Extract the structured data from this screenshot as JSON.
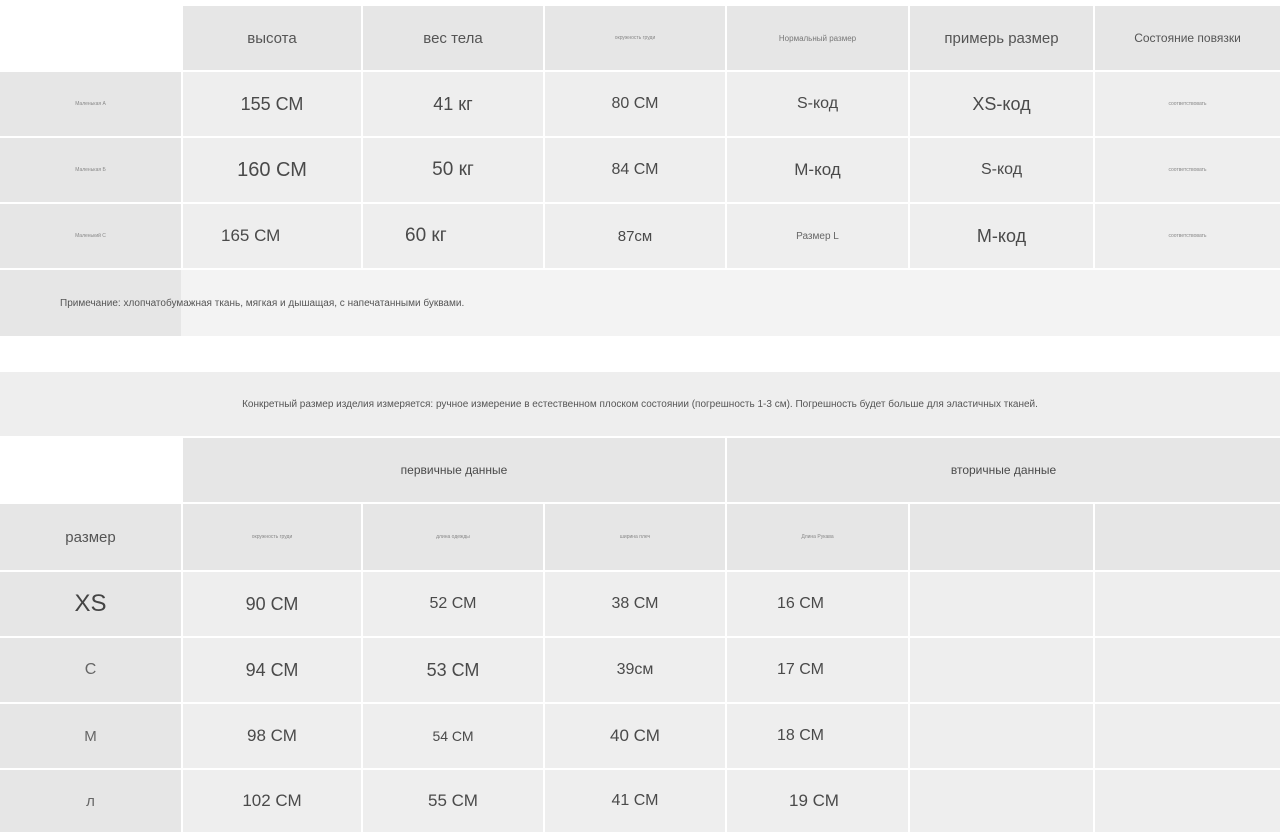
{
  "table1": {
    "headers": [
      "",
      "высота",
      "вес тела",
      "окружность груди",
      "Нормальный размер",
      "примерь размер",
      "Состояние повязки"
    ],
    "rows": [
      [
        "Маленькая А",
        "155 СМ",
        "41 кг",
        "80 СМ",
        "S-код",
        "XS-код",
        "соответствовать"
      ],
      [
        "Маленькая Б",
        "160 СМ",
        "50 кг",
        "84 СМ",
        "М-код",
        "S-код",
        "соответствовать"
      ],
      [
        "Маленький С",
        "165 СМ",
        "60 кг",
        "87см",
        "Размер L",
        "М-код",
        "соответствовать"
      ]
    ],
    "note": "Примечание: хлопчатобумажная ткань, мягкая и дышащая, с напечатанными буквами."
  },
  "banner": "Конкретный размер изделия измеряется: ручное измерение в естественном плоском состоянии (погрешность 1-3 см). Погрешность будет больше для эластичных тканей.",
  "table2": {
    "group_primary": "первичные данные",
    "group_secondary": "вторичные данные",
    "size_label": "размер",
    "subheaders": [
      "окружность груди",
      "длина одежды",
      "ширина плеч",
      "Длина Рукава",
      "",
      ""
    ],
    "rows": [
      [
        "XS",
        "90 СМ",
        "52 СМ",
        "38 СМ",
        "16 СМ",
        "",
        ""
      ],
      [
        "С",
        "94 СМ",
        "53 СМ",
        "39см",
        "17 СМ",
        "",
        ""
      ],
      [
        "М",
        "98 СМ",
        "54 СМ",
        "40 СМ",
        "18 СМ",
        "",
        ""
      ],
      [
        "л",
        "102 СМ",
        "55 СМ",
        "41 СМ",
        "19 СМ",
        "",
        ""
      ]
    ]
  }
}
